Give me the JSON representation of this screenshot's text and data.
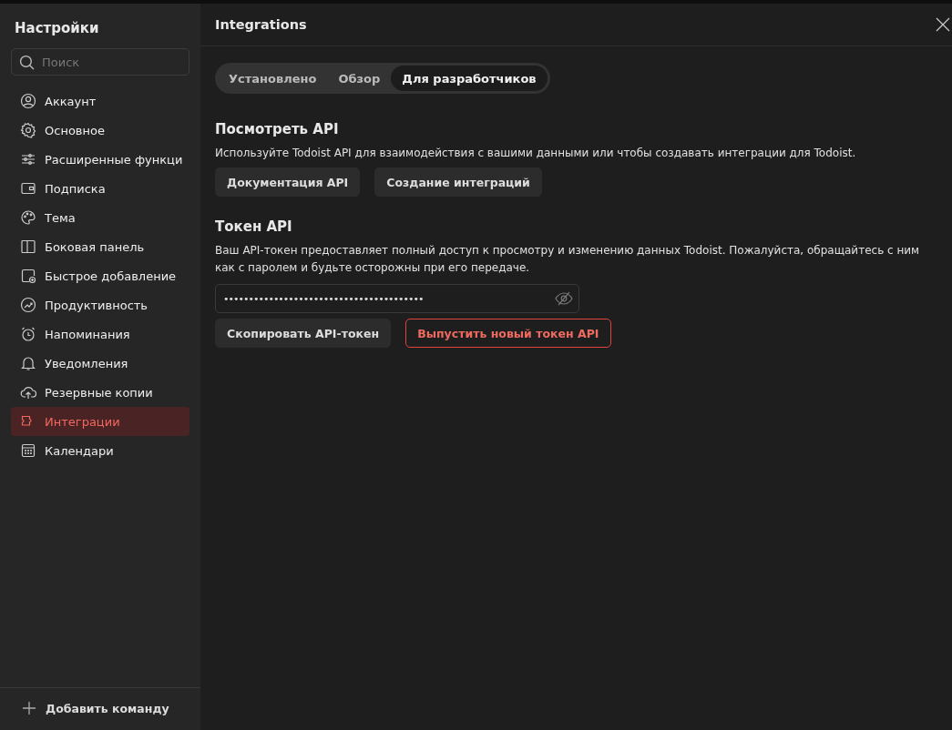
{
  "sidebar": {
    "title": "Настройки",
    "search": {
      "placeholder": "Поиск"
    },
    "items": [
      {
        "label": "Аккаунт",
        "selected": false
      },
      {
        "label": "Основное",
        "selected": false
      },
      {
        "label": "Расширенные функци",
        "selected": false
      },
      {
        "label": "Подписка",
        "selected": false
      },
      {
        "label": "Тема",
        "selected": false
      },
      {
        "label": "Боковая панель",
        "selected": false
      },
      {
        "label": "Быстрое добавление",
        "selected": false
      },
      {
        "label": "Продуктивность",
        "selected": false
      },
      {
        "label": "Напоминания",
        "selected": false
      },
      {
        "label": "Уведомления",
        "selected": false
      },
      {
        "label": "Резервные копии",
        "selected": false
      },
      {
        "label": "Интеграции",
        "selected": true
      },
      {
        "label": "Календари",
        "selected": false
      }
    ],
    "footer": "Добавить команду"
  },
  "window": {
    "title": "Integrations"
  },
  "tabs": [
    {
      "label": "Установлено",
      "selected": false
    },
    {
      "label": "Обзор",
      "selected": false
    },
    {
      "label": "Для разработчиков",
      "selected": true
    }
  ],
  "api_section": {
    "heading": "Посмотреть API",
    "text": "Используйте Todoist API для взаимодействия с вашими данными или чтобы создавать интеграции для Todoist.",
    "buttons": [
      "Документация API",
      "Создание интеграций"
    ]
  },
  "token_section": {
    "heading": "Токен API",
    "text": "Ваш API-токен предоставляет полный доступ к просмотру и изменению данных Todoist. Пожалуйста, обращайтесь с ним как с паролем и будьте осторожны при его передаче.",
    "token": "••••••••••••••••••••••••••••••••••••••••",
    "copy_button": "Скопировать API-токен",
    "reissue_button": "Выпустить новый токен API"
  }
}
